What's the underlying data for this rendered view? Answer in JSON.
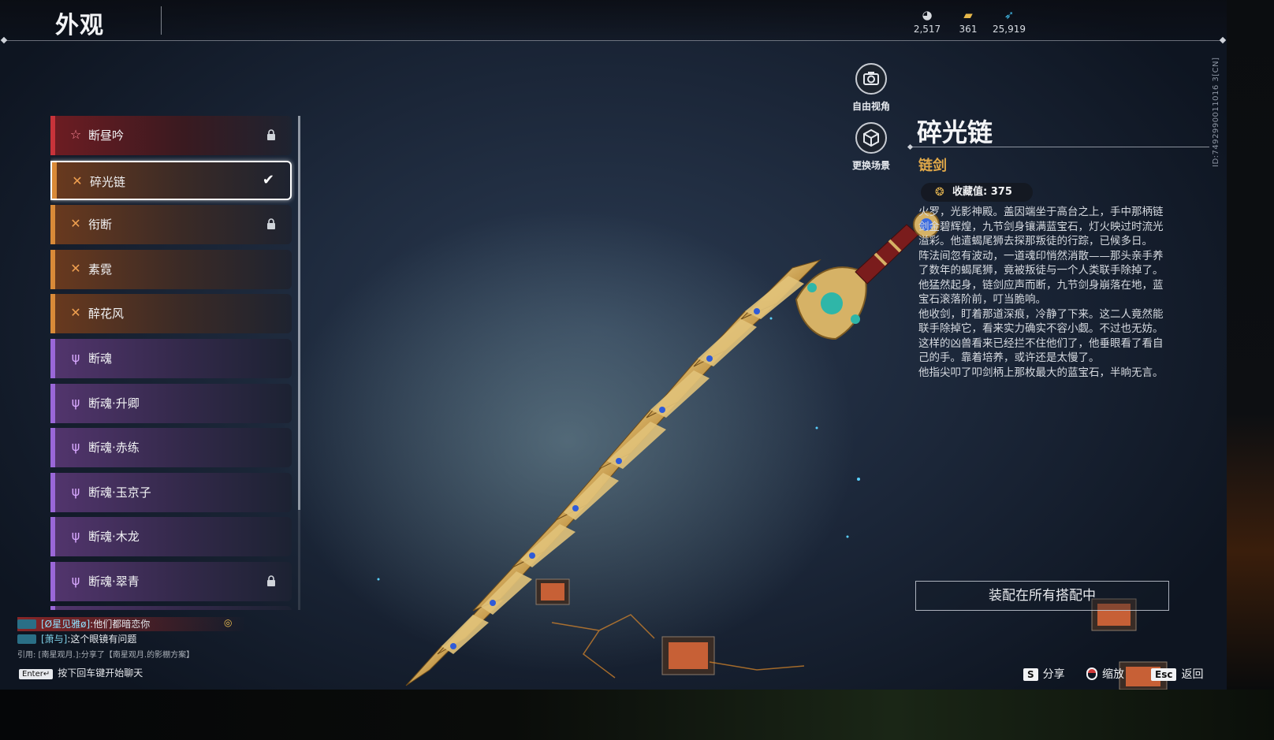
{
  "header": {
    "title": "外观",
    "currencies": [
      {
        "icon": "coin-stack-icon",
        "value": "2,517"
      },
      {
        "icon": "gold-ingot-icon",
        "value": "361"
      },
      {
        "icon": "feather-icon",
        "value": "25,919"
      }
    ]
  },
  "build_id": "ID:7492990011016 3[CN]",
  "list": {
    "items": [
      {
        "label": "断昼吟",
        "rarity": "red",
        "icon": "star-icon",
        "state": "locked"
      },
      {
        "label": "碎光链",
        "rarity": "orange",
        "icon": "cross-icon",
        "state": "selected"
      },
      {
        "label": "衔断",
        "rarity": "orange",
        "icon": "cross-icon",
        "state": "locked"
      },
      {
        "label": "素霓",
        "rarity": "orange",
        "icon": "cross-icon",
        "state": ""
      },
      {
        "label": "醉花风",
        "rarity": "orange",
        "icon": "cross-icon",
        "state": ""
      },
      {
        "label": "断魂",
        "rarity": "purple",
        "icon": "trident-icon",
        "state": ""
      },
      {
        "label": "断魂·升卿",
        "rarity": "purple",
        "icon": "trident-icon",
        "state": ""
      },
      {
        "label": "断魂·赤练",
        "rarity": "purple",
        "icon": "trident-icon",
        "state": ""
      },
      {
        "label": "断魂·玉京子",
        "rarity": "purple",
        "icon": "trident-icon",
        "state": ""
      },
      {
        "label": "断魂·木龙",
        "rarity": "purple",
        "icon": "trident-icon",
        "state": ""
      },
      {
        "label": "断魂·翠青",
        "rarity": "purple",
        "icon": "trident-icon",
        "state": "locked"
      }
    ]
  },
  "tools": {
    "free_view": "自由视角",
    "change_scene": "更换场景"
  },
  "detail": {
    "name": "碎光链",
    "type": "链剑",
    "collect_label": "收藏值:",
    "collect_value": "375",
    "lore": [
      "火罗，光影神殿。盖因端坐于高台之上，手中那柄链剑金碧辉煌，九节剑身镶满蓝宝石，灯火映过时流光溢彩。他遣蝎尾狮去探那叛徒的行踪，已候多日。",
      "阵法间忽有波动，一道魂印悄然消散——那头亲手养了数年的蝎尾狮，竟被叛徒与一个人类联手除掉了。他猛然起身，链剑应声而断，九节剑身崩落在地，蓝宝石滚落阶前，叮当脆响。",
      "他收剑，盯着那道深痕，冷静了下来。这二人竟然能联手除掉它，看来实力确实不容小觑。不过也无妨。这样的凶兽看来已经拦不住他们了，他垂眼看了看自己的手。靠着培养，或许还是太慢了。",
      "他指尖叩了叩剑柄上那枚最大的蓝宝石，半晌无言。"
    ],
    "equip_button": "装配在所有搭配中"
  },
  "chat": {
    "line1_name": "[Ø星见雅ø]",
    "line1_text": ":他们都暗恋你",
    "line2_name": "[萧与]",
    "line2_text": ":这个眼镜有问题",
    "line3": "引用: [南星观月.]:分享了【南星观月.的影棚方案】",
    "enter_key": "Enter↵",
    "enter_hint": "按下回车键开始聊天"
  },
  "bottom_keys": [
    {
      "key": "S",
      "label": "分享"
    },
    {
      "key": "mouse-icon",
      "label": "缩放"
    },
    {
      "key": "Esc",
      "label": "返回"
    }
  ],
  "colors": {
    "accent_gold": "#e0a849",
    "rarity_red": "#c8333a",
    "rarity_orange": "#d98a38",
    "rarity_purple": "#9a67d8"
  }
}
